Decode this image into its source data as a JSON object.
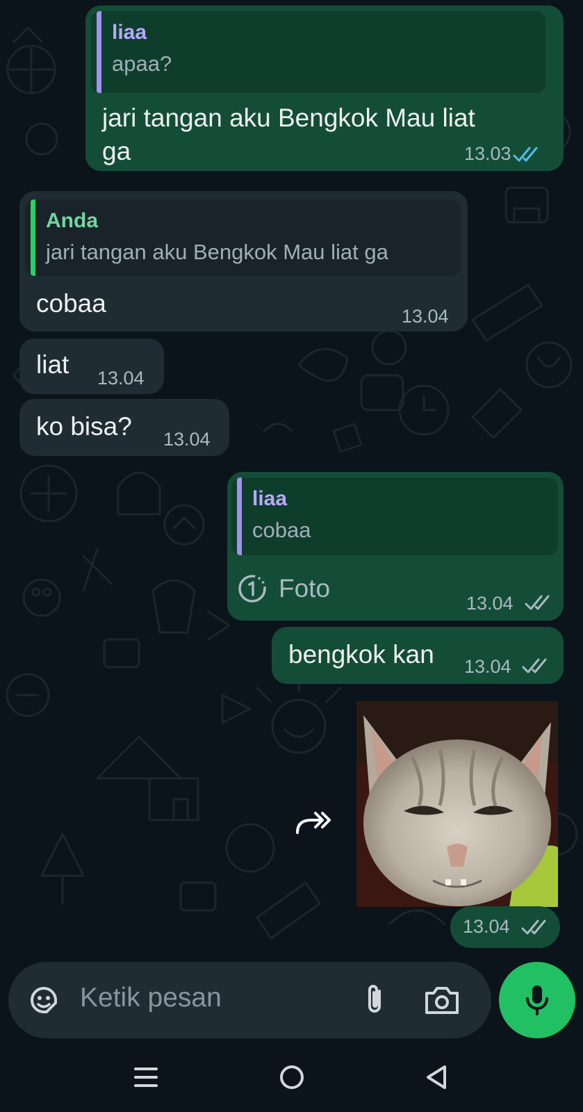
{
  "messages": [
    {
      "reply_author": "liaa",
      "reply_text": "apaa?",
      "text_line1": "jari tangan aku Bengkok Mau liat",
      "text_line2": "ga",
      "time": "13.03"
    },
    {
      "reply_author": "Anda",
      "reply_text": "jari tangan aku Bengkok Mau liat ga",
      "text": "cobaa",
      "time": "13.04"
    },
    {
      "text": "liat",
      "time": "13.04"
    },
    {
      "text": "ko bisa?",
      "time": "13.04"
    },
    {
      "reply_author": "liaa",
      "reply_text": "cobaa",
      "media_label": "Foto",
      "time": "13.04"
    },
    {
      "text": "bengkok kan",
      "time": "13.04"
    },
    {
      "time": "13.04"
    }
  ],
  "composer": {
    "placeholder": "Ketik pesan"
  },
  "icons": [
    "sticker-icon",
    "attach-icon",
    "camera-icon",
    "mic-icon",
    "forward-icon",
    "view-once-icon",
    "menu-icon",
    "home-icon",
    "back-icon",
    "double-check-icon"
  ],
  "colors": {
    "background": "#0b141a",
    "outgoing": "#144d37",
    "incoming": "#202c33",
    "accent": "#21c063",
    "read_tick": "#53bdeb",
    "quote_bar_purple": "#a392f2",
    "quote_bar_green": "#25d366"
  }
}
